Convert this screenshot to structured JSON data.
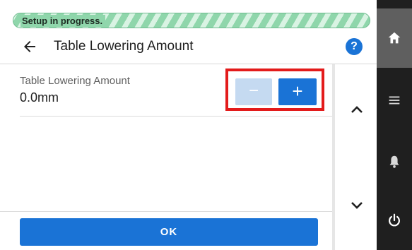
{
  "status": {
    "text": "Setup in progress."
  },
  "header": {
    "title": "Table Lowering Amount",
    "back_icon": "arrow-back-icon",
    "help_icon": "help-icon",
    "help_glyph": "?"
  },
  "setting": {
    "label": "Table Lowering Amount",
    "value": "0.0mm",
    "decrement_label": "−",
    "increment_label": "+",
    "decrement_enabled": false
  },
  "scroll": {
    "up_icon": "chevron-up-icon",
    "down_icon": "chevron-down-icon"
  },
  "footer": {
    "ok_label": "OK"
  },
  "sidebar": {
    "items": [
      "home-icon",
      "menu-icon",
      "bell-icon",
      "power-icon"
    ]
  },
  "colors": {
    "accent": "#1a73d6",
    "accent_disabled": "#c5daf1",
    "highlight": "#e31b1b",
    "progress": "#8fd6ab",
    "sidebar": "#1f1f1f"
  }
}
